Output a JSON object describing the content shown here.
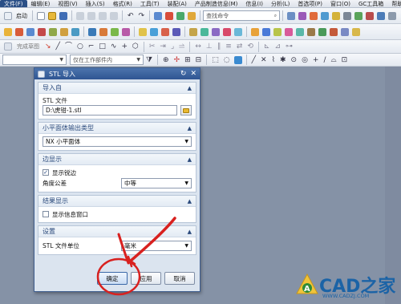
{
  "menubar": {
    "items": [
      "文件(F)",
      "编辑(E)",
      "视图(V)",
      "插入(S)",
      "格式(R)",
      "工具(T)",
      "装配(A)",
      "产品制造信息(M)",
      "信息(I)",
      "分析(L)",
      "首选项(P)",
      "窗口(O)",
      "GC工具箱",
      "帮助(H)"
    ]
  },
  "toolbar1": {
    "start_label": "启动",
    "command_search_placeholder": "查找命令"
  },
  "toolbar3": {
    "inactive_label": "完成草图"
  },
  "toolbar4": {
    "filter_value": "",
    "scope_value": "仅在工作部件内"
  },
  "dialog": {
    "title": "STL 导入",
    "sections": {
      "import_from": {
        "header": "导入自",
        "file_label": "STL 文件",
        "file_value": "D:\\虎钳-1.stl"
      },
      "facet_output": {
        "header": "小平面体输出类型",
        "type_value": "NX 小平面体"
      },
      "edge_display": {
        "header": "边显示",
        "show_sharp_edges_label": "显示锐边",
        "show_sharp_edges_checked": true,
        "angle_tolerance_label": "角度公差",
        "angle_tolerance_value": "中等"
      },
      "result_display": {
        "header": "结果显示",
        "show_info_window_label": "显示信息窗口",
        "show_info_window_checked": false
      },
      "settings": {
        "header": "设置",
        "unit_label": "STL 文件单位",
        "unit_value": "毫米"
      }
    },
    "buttons": {
      "ok": "确定",
      "apply": "应用",
      "cancel": "取消"
    }
  },
  "watermark": {
    "logo_text": "CAD之家",
    "url_text": "WWW.CADZJ.COM"
  },
  "colors": {
    "title_bar": "#2f5592",
    "annotation_red": "#d8211f",
    "watermark_blue": "#1b63a6"
  }
}
